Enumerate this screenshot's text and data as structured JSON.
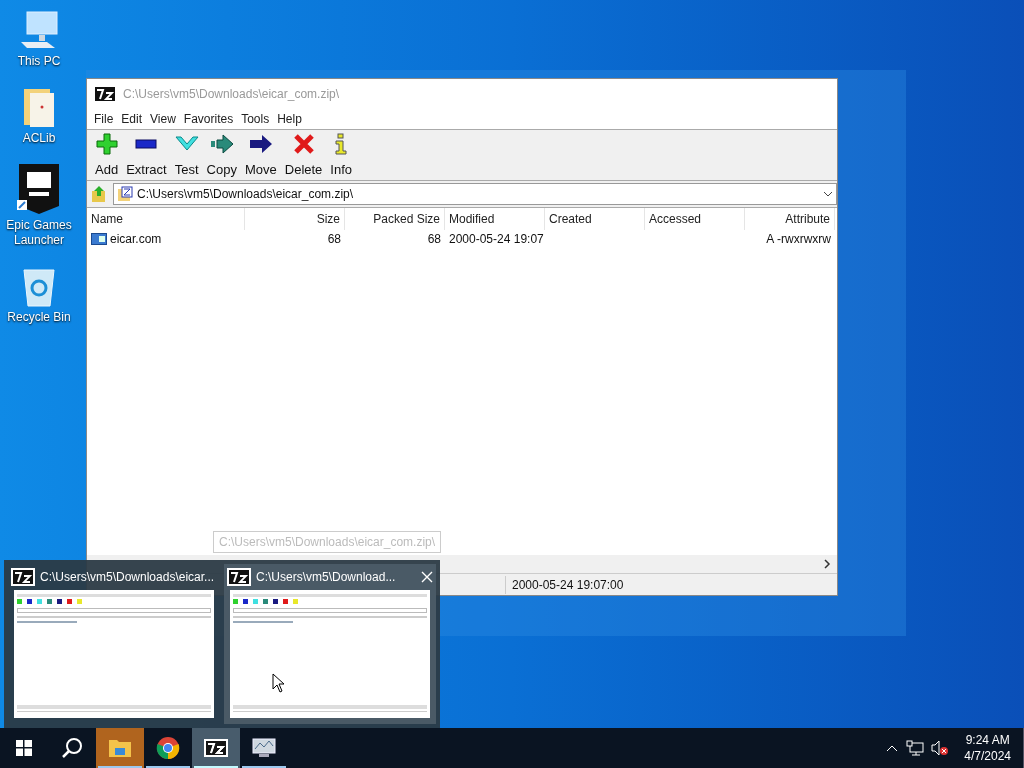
{
  "desktop_icons": [
    {
      "label": "This PC",
      "kind": "pc"
    },
    {
      "label": "ACLib",
      "kind": "folder"
    },
    {
      "label": "Epic Games Launcher",
      "kind": "epic"
    },
    {
      "label": "Recycle Bin",
      "kind": "bin"
    }
  ],
  "window": {
    "title": "C:\\Users\\vm5\\Downloads\\eicar_com.zip\\",
    "menu": [
      "File",
      "Edit",
      "View",
      "Favorites",
      "Tools",
      "Help"
    ],
    "toolbar": [
      {
        "label": "Add",
        "kind": "add"
      },
      {
        "label": "Extract",
        "kind": "extract"
      },
      {
        "label": "Test",
        "kind": "test"
      },
      {
        "label": "Copy",
        "kind": "copy"
      },
      {
        "label": "Move",
        "kind": "move"
      },
      {
        "label": "Delete",
        "kind": "delete"
      },
      {
        "label": "Info",
        "kind": "info"
      }
    ],
    "address": "C:\\Users\\vm5\\Downloads\\eicar_com.zip\\",
    "columns": [
      {
        "label": "Name",
        "kind": "text"
      },
      {
        "label": "Size",
        "kind": "number"
      },
      {
        "label": "Packed Size",
        "kind": "number"
      },
      {
        "label": "Modified",
        "kind": "text"
      },
      {
        "label": "Created",
        "kind": "text"
      },
      {
        "label": "Accessed",
        "kind": "text"
      },
      {
        "label": "Attribute",
        "kind": "number"
      }
    ],
    "rows": [
      [
        "eicar.com",
        "68",
        "68",
        "2000-05-24 19:07",
        "",
        "",
        "A -rwxrwxrw"
      ]
    ],
    "status_bar": [
      "2000-05-24 19:07:00"
    ]
  },
  "tooltip": "C:\\Users\\vm5\\Downloads\\eicar_com.zip\\",
  "previews": [
    {
      "title": "C:\\Users\\vm5\\Downloads\\eicar...",
      "selected": false
    },
    {
      "title": "C:\\Users\\vm5\\Download...",
      "selected": true
    }
  ],
  "taskbar": [
    {
      "kind": "start",
      "selected": false,
      "running": false,
      "attention": false
    },
    {
      "kind": "search",
      "selected": false,
      "running": false,
      "attention": false
    },
    {
      "kind": "explorer",
      "selected": false,
      "running": true,
      "attention": true
    },
    {
      "kind": "chrome",
      "selected": false,
      "running": true,
      "attention": false
    },
    {
      "kind": "sevenzip",
      "selected": true,
      "running": true,
      "attention": false
    },
    {
      "kind": "monitor",
      "selected": false,
      "running": true,
      "attention": false
    }
  ],
  "tray": {
    "time": "9:24 AM",
    "date": "4/7/2024"
  }
}
